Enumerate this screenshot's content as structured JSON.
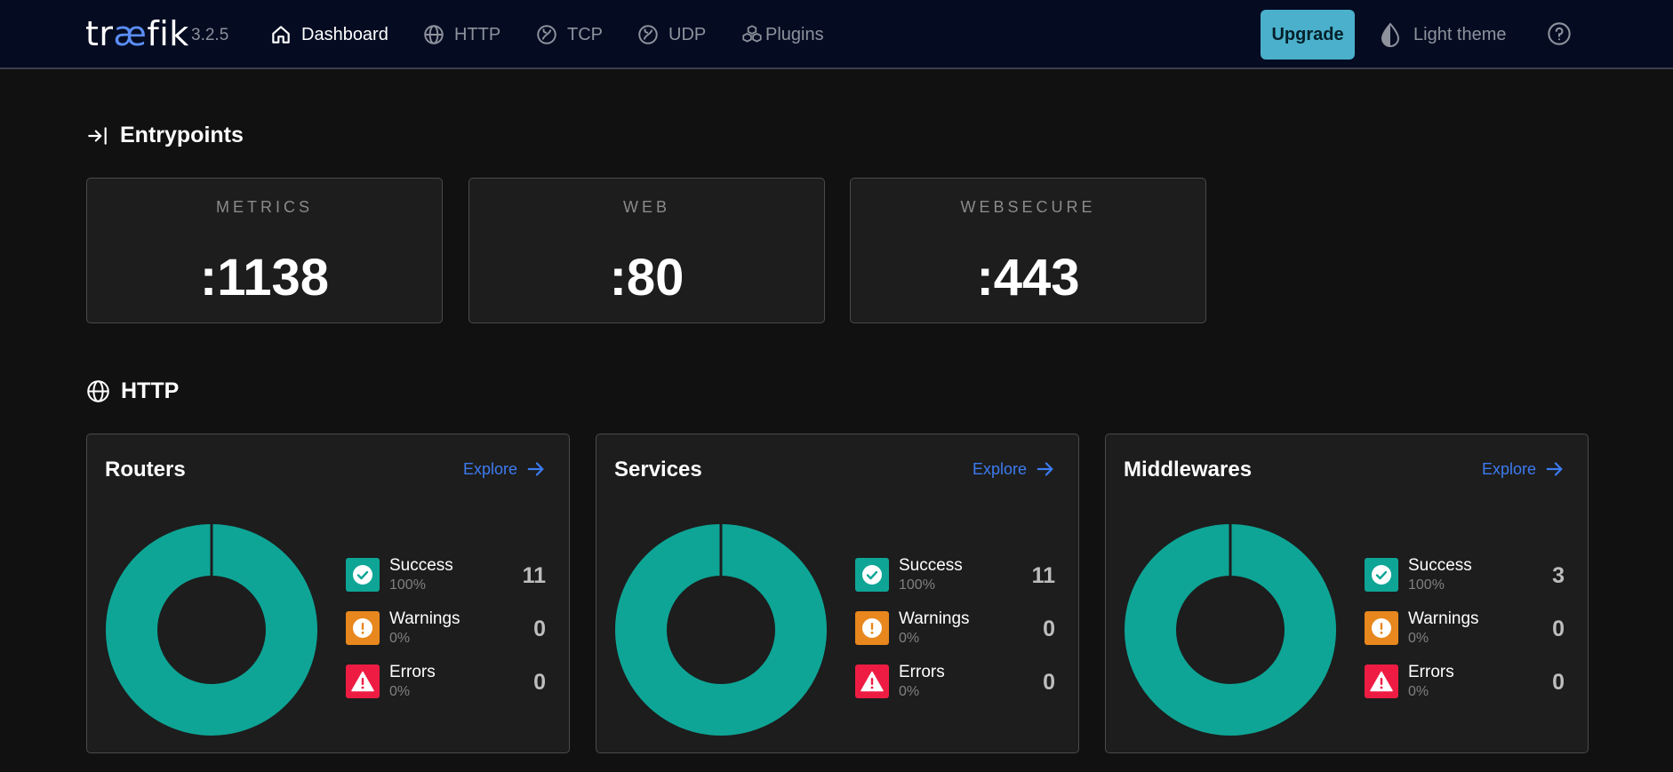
{
  "header": {
    "logo_pre": "tr",
    "logo_ae": "æ",
    "logo_post": "fik",
    "version": "3.2.5",
    "nav": [
      {
        "label": "Dashboard",
        "icon": "home-icon",
        "active": true
      },
      {
        "label": "HTTP",
        "icon": "globe-icon",
        "active": false
      },
      {
        "label": "TCP",
        "icon": "tcp-icon",
        "active": false
      },
      {
        "label": "UDP",
        "icon": "udp-icon",
        "active": false
      },
      {
        "label": "Plugins",
        "icon": "plugins-icon",
        "active": false
      }
    ],
    "upgrade_label": "Upgrade",
    "theme_label": "Light theme"
  },
  "entrypoints": {
    "title": "Entrypoints",
    "items": [
      {
        "name": "METRICS",
        "port": ":1138"
      },
      {
        "name": "WEB",
        "port": ":80"
      },
      {
        "name": "WEBSECURE",
        "port": ":443"
      }
    ]
  },
  "http": {
    "title": "HTTP",
    "explore_label": "Explore",
    "cards": [
      {
        "title": "Routers",
        "success_count": "11",
        "success_pct": "100%",
        "warnings_count": "0",
        "warnings_pct": "0%",
        "errors_count": "0",
        "errors_pct": "0%",
        "success_ratio": 1.0
      },
      {
        "title": "Services",
        "success_count": "11",
        "success_pct": "100%",
        "warnings_count": "0",
        "warnings_pct": "0%",
        "errors_count": "0",
        "errors_pct": "0%",
        "success_ratio": 1.0
      },
      {
        "title": "Middlewares",
        "success_count": "3",
        "success_pct": "100%",
        "warnings_count": "0",
        "warnings_pct": "0%",
        "errors_count": "0",
        "errors_pct": "0%",
        "success_ratio": 1.0
      }
    ],
    "legend": {
      "success": "Success",
      "warnings": "Warnings",
      "errors": "Errors"
    }
  },
  "colors": {
    "success": "#0ea596",
    "warning": "#e7871d",
    "error": "#ee1c43",
    "accent": "#4ab0cb",
    "link": "#3d7bf0"
  }
}
